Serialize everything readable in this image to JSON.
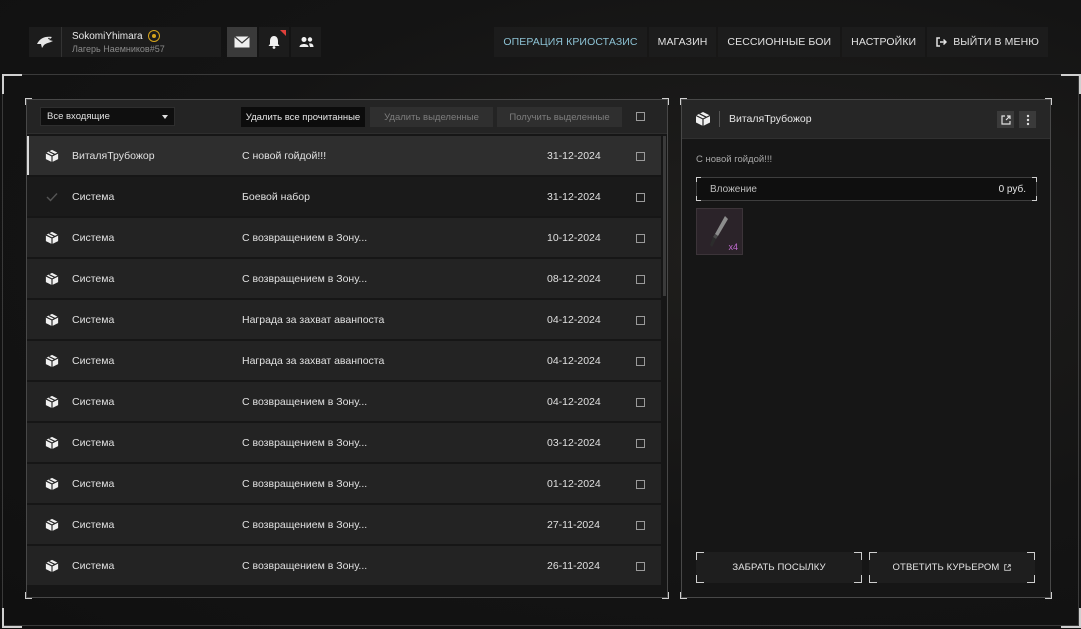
{
  "profile": {
    "name": "SokomiYhimara",
    "subtitle": "Лагерь Наемников#57"
  },
  "header_icons": [
    "mail-icon",
    "bell-icon",
    "friends-icon"
  ],
  "nav": {
    "items": [
      {
        "label": "ОПЕРАЦИЯ КРИОСТАЗИС",
        "active": true
      },
      {
        "label": "МАГАЗИН"
      },
      {
        "label": "СЕССИОННЫЕ БОИ"
      },
      {
        "label": "НАСТРОЙКИ"
      },
      {
        "label": "ВЫЙТИ В МЕНЮ"
      }
    ]
  },
  "mail": {
    "filter": "Все входящие",
    "delete_read": "Удалить все прочитанные",
    "delete_selected": "Удалить выделенные",
    "get_selected": "Получить выделенные",
    "rows": [
      {
        "sender": "ВиталяТрубожор",
        "subject": "С новой гойдой!!!",
        "date": "31-12-2024",
        "state": "selected"
      },
      {
        "sender": "Система",
        "subject": "Боевой набор",
        "date": "31-12-2024",
        "state": "read"
      },
      {
        "sender": "Система",
        "subject": "С возвращением в Зону...",
        "date": "10-12-2024"
      },
      {
        "sender": "Система",
        "subject": "С возвращением в Зону...",
        "date": "08-12-2024"
      },
      {
        "sender": "Система",
        "subject": "Награда за захват аванпоста",
        "date": "04-12-2024"
      },
      {
        "sender": "Система",
        "subject": "Награда за захват аванпоста",
        "date": "04-12-2024"
      },
      {
        "sender": "Система",
        "subject": "С возвращением в Зону...",
        "date": "04-12-2024"
      },
      {
        "sender": "Система",
        "subject": "С возвращением в Зону...",
        "date": "03-12-2024"
      },
      {
        "sender": "Система",
        "subject": "С возвращением в Зону...",
        "date": "01-12-2024"
      },
      {
        "sender": "Система",
        "subject": "С возвращением в Зону...",
        "date": "27-11-2024"
      },
      {
        "sender": "Система",
        "subject": "С возвращением в Зону...",
        "date": "26-11-2024"
      }
    ]
  },
  "detail": {
    "from": "ВиталяТрубожор",
    "subject": "С новой гойдой!!!",
    "attachment_label": "Вложение",
    "attachment_value": "0 руб.",
    "item_qty": "x4",
    "take_button": "ЗАБРАТЬ ПОСЫЛКУ",
    "reply_button": "ОТВЕТИТЬ КУРЬЕРОМ"
  },
  "colors": {
    "accent": "#8cc1d3",
    "notification": "#e0403a",
    "rarity": "#c26bd1",
    "badge": "#d6a51c"
  }
}
